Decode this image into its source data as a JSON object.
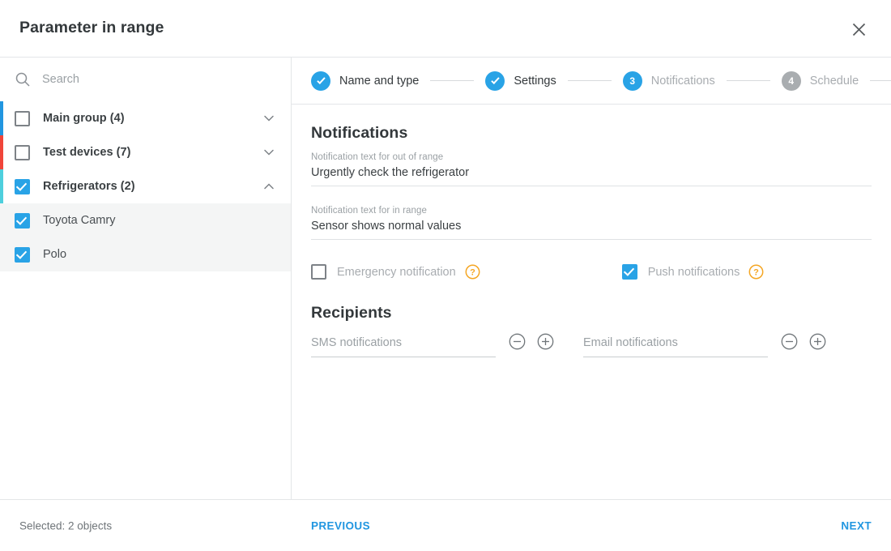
{
  "dialog": {
    "title": "Parameter in range",
    "close_icon": "close-icon"
  },
  "sidebar": {
    "search": {
      "icon": "search-icon",
      "placeholder": "Search",
      "value": ""
    },
    "groups": [
      {
        "label": "Main group (4)",
        "checked": false,
        "expanded": false,
        "bar_color": "#2196e0",
        "chevron": "chevron-down-icon",
        "children": []
      },
      {
        "label": "Test devices (7)",
        "checked": false,
        "expanded": false,
        "bar_color": "#f0453a",
        "chevron": "chevron-down-icon",
        "children": []
      },
      {
        "label": "Refrigerators (2)",
        "checked": true,
        "expanded": true,
        "bar_color": "#4ecfdd",
        "chevron": "chevron-up-icon",
        "children": [
          {
            "label": "Toyota Camry",
            "checked": true
          },
          {
            "label": "Polo",
            "checked": true
          }
        ]
      }
    ]
  },
  "stepper": {
    "steps": [
      {
        "label": "Name and type",
        "marker": "check",
        "state": "done"
      },
      {
        "label": "Settings",
        "marker": "check",
        "state": "done"
      },
      {
        "label": "Notifications",
        "marker": "3",
        "state": "active"
      },
      {
        "label": "Schedule",
        "marker": "4",
        "state": "todo"
      }
    ]
  },
  "main": {
    "notifications": {
      "heading": "Notifications",
      "out_of_range": {
        "label": "Notification text for out of range",
        "value": "Urgently check the refrigerator"
      },
      "in_range": {
        "label": "Notification text for in range",
        "value": "Sensor shows normal values"
      },
      "emergency": {
        "label": "Emergency notification",
        "checked": false,
        "help_icon": "help-circle-icon"
      },
      "push": {
        "label": "Push notifications",
        "checked": true,
        "help_icon": "help-circle-icon"
      }
    },
    "recipients": {
      "heading": "Recipients",
      "sms": {
        "placeholder": "SMS notifications",
        "value": "",
        "remove_icon": "minus-circle-icon",
        "add_icon": "plus-circle-icon"
      },
      "email": {
        "placeholder": "Email notifications",
        "value": "",
        "remove_icon": "minus-circle-icon",
        "add_icon": "plus-circle-icon"
      }
    }
  },
  "footer": {
    "selected_text": "Selected: 2 objects",
    "previous_label": "PREVIOUS",
    "next_label": "NEXT"
  },
  "colors": {
    "accent_blue": "#29a3e6",
    "link_blue": "#2196e0",
    "help_orange": "#f5a623",
    "group_blue": "#2196e0",
    "group_red": "#f0453a",
    "group_cyan": "#4ecfdd"
  }
}
